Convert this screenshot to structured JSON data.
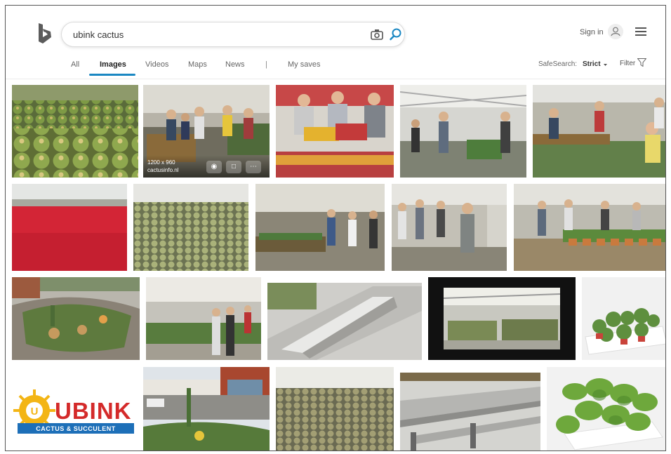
{
  "search": {
    "query": "ubink cactus"
  },
  "header": {
    "signin_label": "Sign in"
  },
  "tabs": [
    {
      "label": "All",
      "active": false
    },
    {
      "label": "Images",
      "active": true
    },
    {
      "label": "Videos",
      "active": false
    },
    {
      "label": "Maps",
      "active": false
    },
    {
      "label": "News",
      "active": false
    },
    {
      "label": "|",
      "active": false
    },
    {
      "label": "My saves",
      "active": false
    }
  ],
  "filters": {
    "safesearch_label": "SafeSearch:",
    "safesearch_value": "Strict",
    "filter_label": "Filter"
  },
  "hover_card": {
    "size": "1200 x 960",
    "source": "cactusinfo.nl"
  },
  "logo_tile": {
    "brand": "UBINK",
    "tagline": "CACTUS & SUCCULENT"
  },
  "colors": {
    "accent": "#1a87c2",
    "bing_logo": "#5c5c5c",
    "brand_red": "#d42a2a",
    "brand_blue": "#1d6fb8",
    "brand_yellow": "#f3b515"
  }
}
